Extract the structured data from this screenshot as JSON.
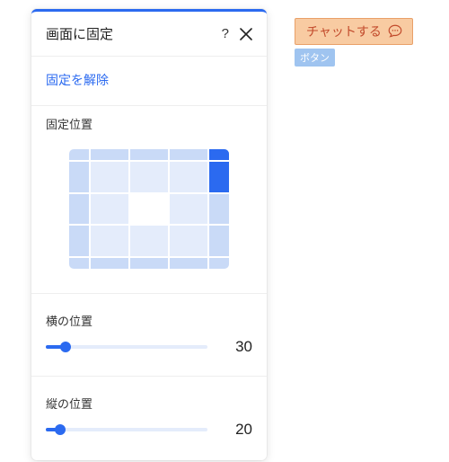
{
  "panel": {
    "title": "画面に固定",
    "unpin_link": "固定を解除",
    "position_label": "固定位置",
    "horizontal": {
      "label": "横の位置",
      "value": 30
    },
    "vertical": {
      "label": "縦の位置",
      "value": 20
    }
  },
  "chat": {
    "label": "チャットする"
  },
  "badge": {
    "label": "ボタン"
  }
}
